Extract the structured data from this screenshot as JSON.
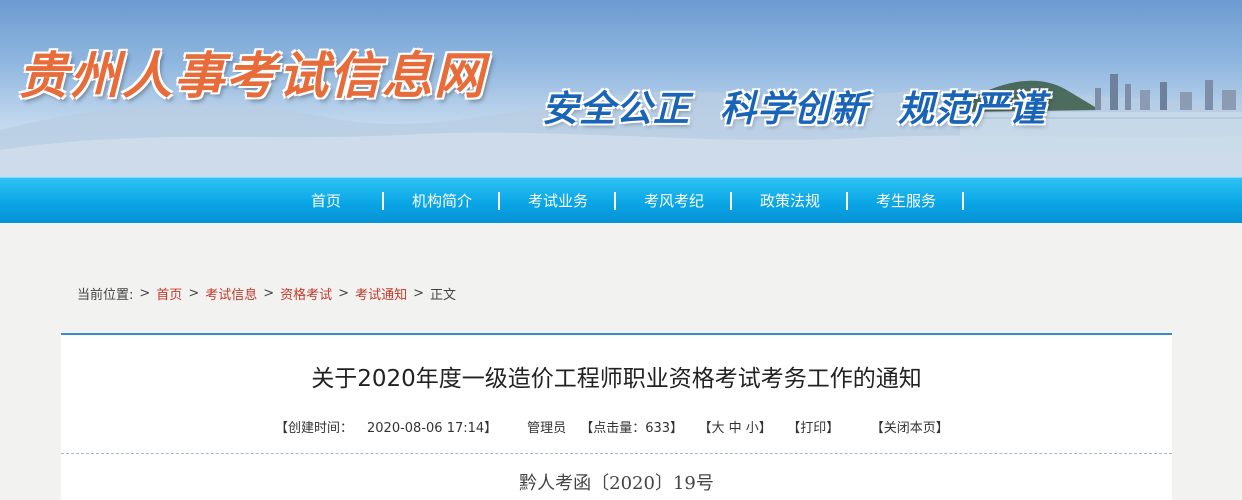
{
  "banner": {
    "site_title": "贵州人事考试信息网",
    "slogan": [
      "安全公正",
      "科学创新",
      "规范严谨"
    ]
  },
  "nav": {
    "items": [
      "首页",
      "机构简介",
      "考试业务",
      "考风考纪",
      "政策法规",
      "考生服务"
    ]
  },
  "breadcrumb": {
    "label": "当前位置:",
    "items": [
      "首页",
      "考试信息",
      "资格考试",
      "考试通知"
    ],
    "current": "正文",
    "separator": ">"
  },
  "article": {
    "title": "关于2020年度一级造价工程师职业资格考试考务工作的通知",
    "meta": {
      "created": "【创建时间：",
      "created_value": "2020-08-06 17:14】",
      "author": "管理员",
      "views": "【点击量：633】",
      "font_size": "【大 中 小】",
      "print": "【打印】",
      "close": "【关闭本页】"
    },
    "doc_number": "黔人考函〔2020〕19号"
  },
  "colors": {
    "nav_bg": "#0aa6e6",
    "title_orange": "#e86b3a",
    "slogan_blue": "#1a64b8",
    "link_red": "#c0392b",
    "panel_accent": "#3a8ad2"
  }
}
